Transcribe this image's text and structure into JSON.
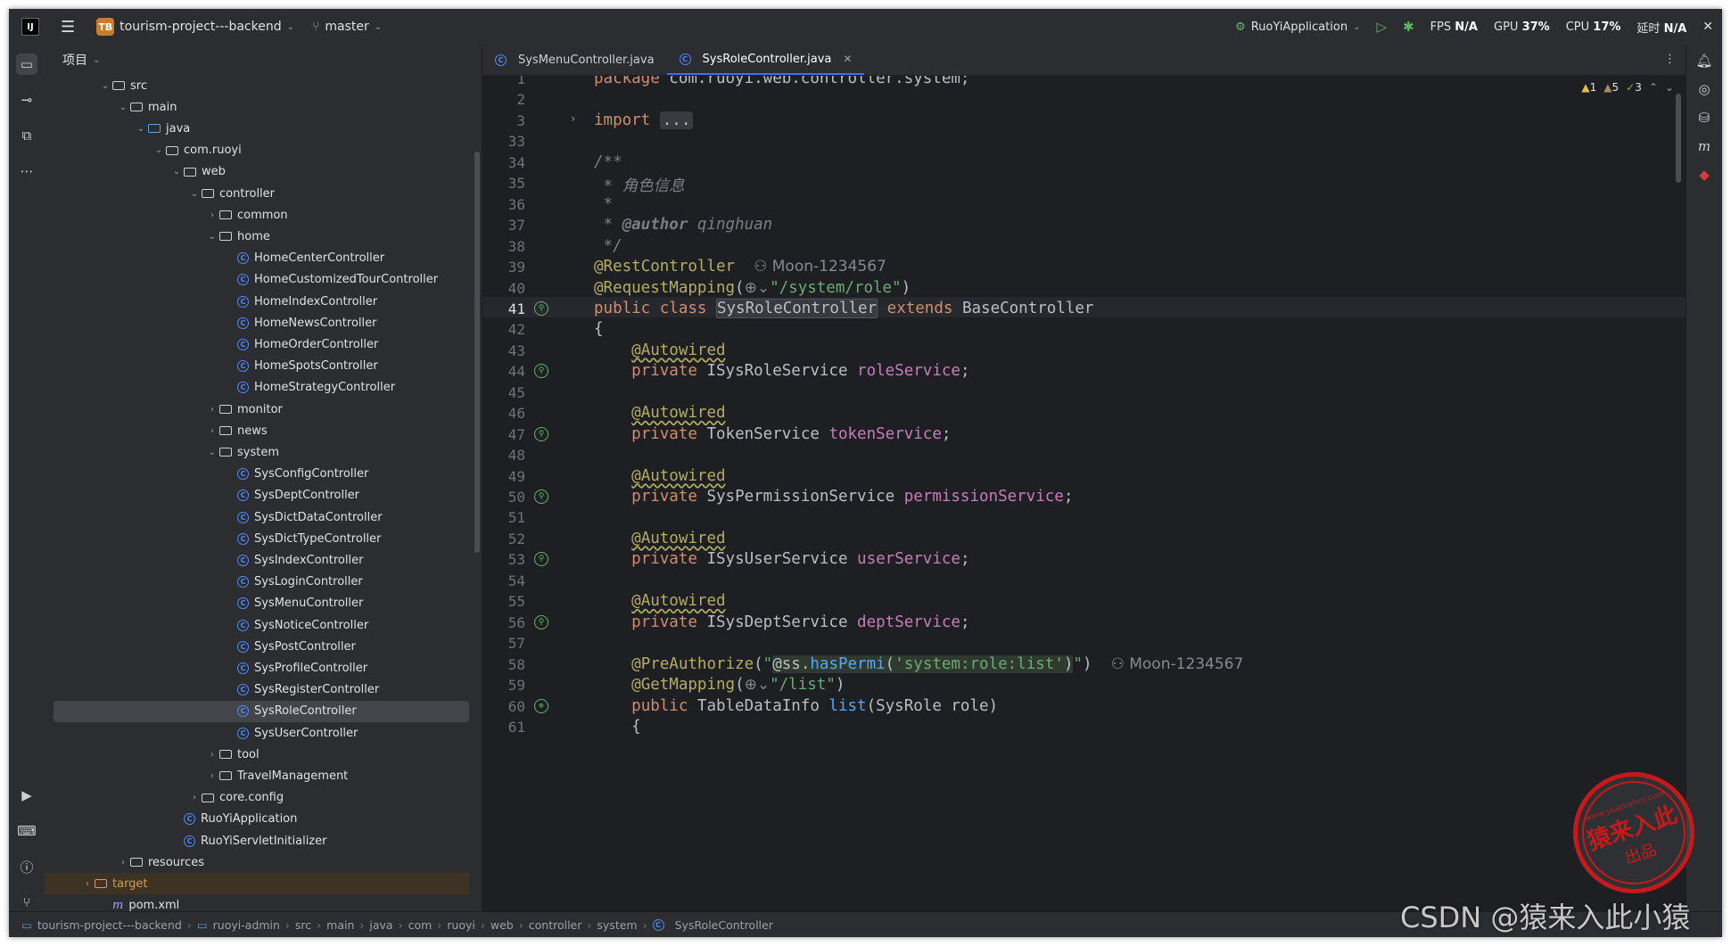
{
  "topbar": {
    "project_badge": "TB",
    "project_name": "tourism-project---backend",
    "branch": "master",
    "run_config": "RuoYiApplication",
    "fps_label": "FPS",
    "fps_value": "N/A",
    "gpu_label": "GPU",
    "gpu_value": "37%",
    "cpu_label": "CPU",
    "cpu_value": "17%",
    "time_label": "延时",
    "time_value": "N/A"
  },
  "project_panel": {
    "title": "项目",
    "items": [
      {
        "label": "src",
        "depth": 3,
        "kind": "folder",
        "arrow": "open"
      },
      {
        "label": "main",
        "depth": 4,
        "kind": "folder",
        "arrow": "open"
      },
      {
        "label": "java",
        "depth": 5,
        "kind": "src-folder",
        "arrow": "open"
      },
      {
        "label": "com.ruoyi",
        "depth": 6,
        "kind": "package",
        "arrow": "open"
      },
      {
        "label": "web",
        "depth": 7,
        "kind": "package",
        "arrow": "open"
      },
      {
        "label": "controller",
        "depth": 8,
        "kind": "package",
        "arrow": "open"
      },
      {
        "label": "common",
        "depth": 9,
        "kind": "package",
        "arrow": "closed"
      },
      {
        "label": "home",
        "depth": 9,
        "kind": "package",
        "arrow": "open"
      },
      {
        "label": "HomeCenterController",
        "depth": 10,
        "kind": "class"
      },
      {
        "label": "HomeCustomizedTourController",
        "depth": 10,
        "kind": "class"
      },
      {
        "label": "HomeIndexController",
        "depth": 10,
        "kind": "class"
      },
      {
        "label": "HomeNewsController",
        "depth": 10,
        "kind": "class"
      },
      {
        "label": "HomeOrderController",
        "depth": 10,
        "kind": "class"
      },
      {
        "label": "HomeSpotsController",
        "depth": 10,
        "kind": "class"
      },
      {
        "label": "HomeStrategyController",
        "depth": 10,
        "kind": "class"
      },
      {
        "label": "monitor",
        "depth": 9,
        "kind": "package",
        "arrow": "closed"
      },
      {
        "label": "news",
        "depth": 9,
        "kind": "package",
        "arrow": "closed"
      },
      {
        "label": "system",
        "depth": 9,
        "kind": "package",
        "arrow": "open"
      },
      {
        "label": "SysConfigController",
        "depth": 10,
        "kind": "class"
      },
      {
        "label": "SysDeptController",
        "depth": 10,
        "kind": "class"
      },
      {
        "label": "SysDictDataController",
        "depth": 10,
        "kind": "class"
      },
      {
        "label": "SysDictTypeController",
        "depth": 10,
        "kind": "class"
      },
      {
        "label": "SysIndexController",
        "depth": 10,
        "kind": "class"
      },
      {
        "label": "SysLoginController",
        "depth": 10,
        "kind": "class"
      },
      {
        "label": "SysMenuController",
        "depth": 10,
        "kind": "class"
      },
      {
        "label": "SysNoticeController",
        "depth": 10,
        "kind": "class"
      },
      {
        "label": "SysPostController",
        "depth": 10,
        "kind": "class"
      },
      {
        "label": "SysProfileController",
        "depth": 10,
        "kind": "class"
      },
      {
        "label": "SysRegisterController",
        "depth": 10,
        "kind": "class"
      },
      {
        "label": "SysRoleController",
        "depth": 10,
        "kind": "class",
        "selected": true
      },
      {
        "label": "SysUserController",
        "depth": 10,
        "kind": "class"
      },
      {
        "label": "tool",
        "depth": 9,
        "kind": "package",
        "arrow": "closed"
      },
      {
        "label": "TravelManagement",
        "depth": 9,
        "kind": "package",
        "arrow": "closed"
      },
      {
        "label": "core.config",
        "depth": 8,
        "kind": "package",
        "arrow": "closed"
      },
      {
        "label": "RuoYiApplication",
        "depth": 7,
        "kind": "class"
      },
      {
        "label": "RuoYiServletInitializer",
        "depth": 7,
        "kind": "class"
      },
      {
        "label": "resources",
        "depth": 4,
        "kind": "package",
        "arrow": "closed"
      },
      {
        "label": "target",
        "depth": 2,
        "kind": "orange-folder",
        "arrow": "closed",
        "target": true
      },
      {
        "label": "pom.xml",
        "depth": 3,
        "kind": "maven"
      }
    ]
  },
  "tabs": [
    {
      "label": "SysMenuController.java",
      "active": false
    },
    {
      "label": "SysRoleController.java",
      "active": true
    }
  ],
  "inspections": {
    "warnings": "1",
    "weak_warnings": "5",
    "typos": "3"
  },
  "code_lines": [
    {
      "num": "1",
      "html": "<span class=\"kw\">package</span> com.ruoyi.web.controller.system;"
    },
    {
      "num": "2",
      "html": ""
    },
    {
      "num": "3",
      "fold": "›",
      "html": "<span class=\"kw\">import</span> <span class=\"fold-box\">...</span>"
    },
    {
      "num": "33",
      "html": ""
    },
    {
      "num": "34",
      "html": "<span class=\"cmt\">/**</span>"
    },
    {
      "num": "35",
      "html": "<span class=\"cmt\"> * 角色信息</span>"
    },
    {
      "num": "36",
      "html": "<span class=\"cmt\"> *</span>"
    },
    {
      "num": "37",
      "html": "<span class=\"cmt\"> * </span><span class=\"doctag\">@author</span><span class=\"cmt\"> qinghuan</span>"
    },
    {
      "num": "38",
      "html": "<span class=\"cmt\"> */</span>"
    },
    {
      "num": "39",
      "html": "<span class=\"ann\">@RestController</span>  <span class=\"hint\">⚇ Moon-1234567</span>"
    },
    {
      "num": "40",
      "html": "<span class=\"ann\">@RequestMapping</span>(<span class=\"hint\">⊕⌄</span><span class=\"str\">\"/system/role\"</span>)"
    },
    {
      "num": "41",
      "icon": "bean",
      "current": true,
      "html": "<span class=\"kw\">public class</span> <span class=\"ident-hl\">SysRoleController</span> <span class=\"kw\">extends</span> BaseController"
    },
    {
      "num": "42",
      "html": "{"
    },
    {
      "num": "43",
      "html": "    <span class=\"annw\">@Autowired</span>"
    },
    {
      "num": "44",
      "icon": "bean",
      "html": "    <span class=\"kw\">private</span> ISysRoleService <span class=\"fld\">roleService</span>;"
    },
    {
      "num": "45",
      "html": ""
    },
    {
      "num": "46",
      "html": "    <span class=\"annw\">@Autowired</span>"
    },
    {
      "num": "47",
      "icon": "bean",
      "html": "    <span class=\"kw\">private</span> TokenService <span class=\"fld\">tokenService</span>;"
    },
    {
      "num": "48",
      "html": ""
    },
    {
      "num": "49",
      "html": "    <span class=\"annw\">@Autowired</span>"
    },
    {
      "num": "50",
      "icon": "bean",
      "html": "    <span class=\"kw\">private</span> SysPermissionService <span class=\"fld\">permissionService</span>;"
    },
    {
      "num": "51",
      "html": ""
    },
    {
      "num": "52",
      "html": "    <span class=\"annw\">@Autowired</span>"
    },
    {
      "num": "53",
      "icon": "bean",
      "html": "    <span class=\"kw\">private</span> ISysUserService <span class=\"fld\">userService</span>;"
    },
    {
      "num": "54",
      "html": ""
    },
    {
      "num": "55",
      "html": "    <span class=\"annw\">@Autowired</span>"
    },
    {
      "num": "56",
      "icon": "bean",
      "html": "    <span class=\"kw\">private</span> ISysDeptService <span class=\"fld\">deptService</span>;"
    },
    {
      "num": "57",
      "html": ""
    },
    {
      "num": "58",
      "html": "    <span class=\"ann\">@PreAuthorize</span>(<span class=\"str\">\"</span><span class=\"spel\">@ss.<span class=\"meth\">hasPermi</span>(<span class=\"str\">'system:role:list'</span>)</span><span class=\"str\">\"</span>)  <span class=\"hint\">⚇ Moon-1234567</span>"
    },
    {
      "num": "59",
      "html": "    <span class=\"ann\">@GetMapping</span>(<span class=\"hint\">⊕⌄</span><span class=\"str\">\"/list\"</span>)"
    },
    {
      "num": "60",
      "icon": "web",
      "html": "    <span class=\"kw\">public</span> TableDataInfo <span class=\"meth\">list</span>(SysRole role)"
    },
    {
      "num": "61",
      "html": "    {"
    }
  ],
  "breadcrumb": [
    "tourism-project---backend",
    "ruoyi-admin",
    "src",
    "main",
    "java",
    "com",
    "ruoyi",
    "web",
    "controller",
    "system",
    "SysRoleController"
  ],
  "watermark": {
    "stamp_url": "www.yuanlaircc.com",
    "stamp_main": "猿来入此",
    "stamp_sub": "出品",
    "csdn": "CSDN @猿来入此小猿"
  },
  "colors": {
    "accent": "#3574f0",
    "keyword": "#cf8e6d",
    "string": "#6aab73",
    "annotation": "#b3ae60",
    "field": "#c77dbb",
    "stamp": "#c41a1a"
  }
}
